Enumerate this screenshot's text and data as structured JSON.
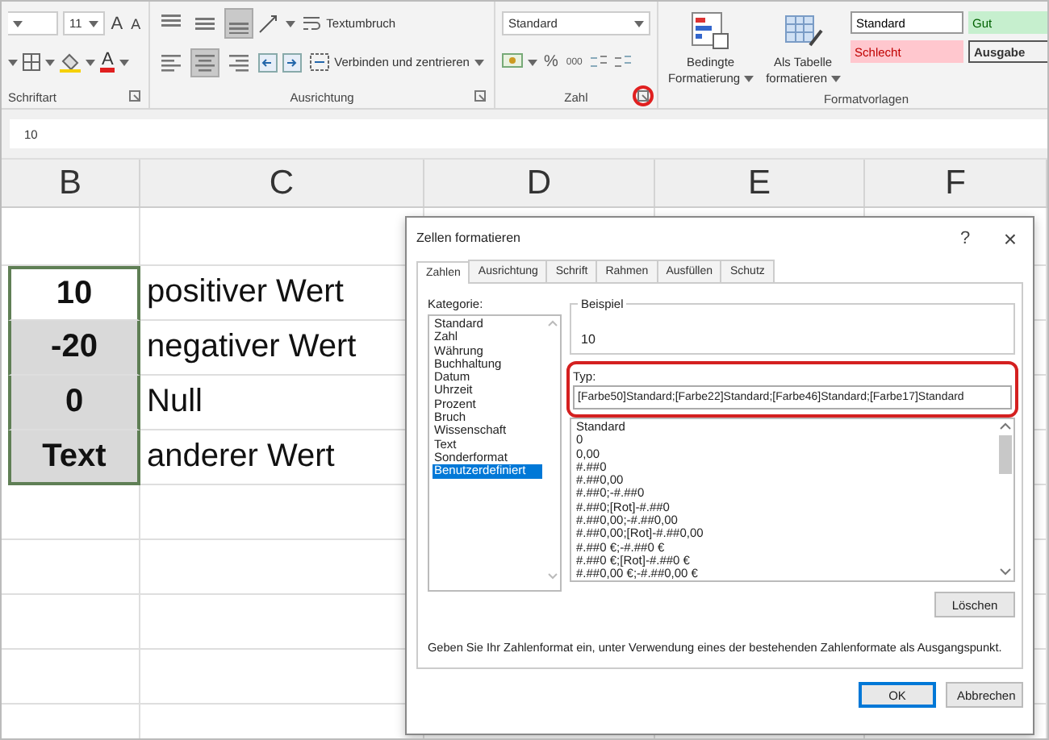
{
  "ribbon": {
    "groups": [
      {
        "kind": "font",
        "label": "Schriftart",
        "font_size": "11",
        "grow": "A",
        "shrink": "A",
        "font_color": "A",
        "launcher_highlighted": false
      },
      {
        "kind": "align",
        "label": "Ausrichtung",
        "vertical": [
          {
            "selected": false
          },
          {
            "selected": false
          },
          {
            "selected": true
          }
        ],
        "horizontal": [
          {
            "selected": false
          },
          {
            "selected": true
          },
          {
            "selected": false
          }
        ],
        "wrap": "Textumbruch",
        "merge": "Verbinden und zentrieren",
        "launcher_highlighted": false
      },
      {
        "kind": "number",
        "label": "Zahl",
        "format": "Standard",
        "percent": "%",
        "thousands": "000",
        "launcher_highlighted": true
      },
      {
        "kind": "styles",
        "label": "Formatvorlagen",
        "buttons": [
          [
            "Bedingte",
            "Formatierung"
          ],
          [
            "Als Tabelle",
            "formatieren"
          ]
        ],
        "styles": [
          {
            "name": "Standard",
            "kind": "normal"
          },
          {
            "name": "Gut",
            "kind": "good"
          },
          {
            "name": "Schlecht",
            "kind": "bad"
          },
          {
            "name": "Ausgabe",
            "kind": "output"
          }
        ]
      }
    ]
  },
  "formula_bar": {
    "value": "10"
  },
  "sheet": {
    "columns": [
      "B",
      "C",
      "D",
      "E",
      "F"
    ],
    "rows": [
      {
        "b": {
          "value": "10",
          "selected": true,
          "active": true
        },
        "c": "positiver Wert"
      },
      {
        "b": {
          "value": "-20",
          "selected": true,
          "active": false
        },
        "c": "negativer Wert"
      },
      {
        "b": {
          "value": "0",
          "selected": true,
          "active": false
        },
        "c": "Null"
      },
      {
        "b": {
          "value": "Text",
          "selected": true,
          "active": false
        },
        "c": "anderer Wert"
      }
    ]
  },
  "dialog": {
    "title": "Zellen formatieren",
    "help": "?",
    "close": "×",
    "tabs": [
      {
        "label": "Zahlen",
        "selected": true
      },
      {
        "label": "Ausrichtung",
        "selected": false
      },
      {
        "label": "Schrift",
        "selected": false
      },
      {
        "label": "Rahmen",
        "selected": false
      },
      {
        "label": "Ausfüllen",
        "selected": false
      },
      {
        "label": "Schutz",
        "selected": false
      }
    ],
    "category_label": "Kategorie:",
    "categories": [
      {
        "label": "Standard",
        "selected": false
      },
      {
        "label": "Zahl",
        "selected": false
      },
      {
        "label": "Währung",
        "selected": false
      },
      {
        "label": "Buchhaltung",
        "selected": false
      },
      {
        "label": "Datum",
        "selected": false
      },
      {
        "label": "Uhrzeit",
        "selected": false
      },
      {
        "label": "Prozent",
        "selected": false
      },
      {
        "label": "Bruch",
        "selected": false
      },
      {
        "label": "Wissenschaft",
        "selected": false
      },
      {
        "label": "Text",
        "selected": false
      },
      {
        "label": "Sonderformat",
        "selected": false
      },
      {
        "label": "Benutzerdefiniert",
        "selected": true
      }
    ],
    "sample_label": "Beispiel",
    "sample": "10",
    "type_label": "Typ:",
    "type_value": "[Farbe50]Standard;[Farbe22]Standard;[Farbe46]Standard;[Farbe17]Standard",
    "type_highlighted": true,
    "formats": [
      "Standard",
      "0",
      "0,00",
      "#.##0",
      "#.##0,00",
      "#.##0;-#.##0",
      "#.##0;[Rot]-#.##0",
      "#.##0,00;-#.##0,00",
      "#.##0,00;[Rot]-#.##0,00",
      "#.##0 €;-#.##0 €",
      "#.##0 €;[Rot]-#.##0 €",
      "#.##0,00 €;-#.##0,00 €"
    ],
    "delete": "Löschen",
    "hint": "Geben Sie Ihr Zahlenformat ein, unter Verwendung eines der bestehenden Zahlenformate als Ausgangspunkt.",
    "buttons": [
      {
        "label": "OK",
        "default": true
      },
      {
        "label": "Abbrechen",
        "default": false
      }
    ]
  }
}
